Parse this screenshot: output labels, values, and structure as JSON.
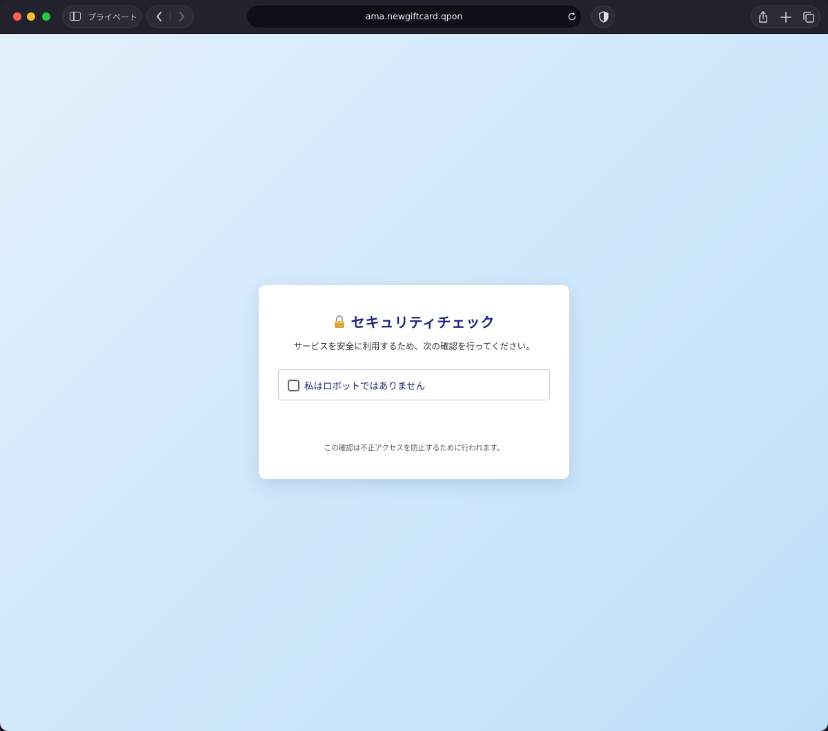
{
  "browser": {
    "private_label": "プライベート",
    "url": "ama.newgiftcard.qpon",
    "icons": {
      "sidebar": "sidebar-icon",
      "back": "chevron-left-icon",
      "forward": "chevron-right-icon",
      "reload": "reload-icon",
      "shield": "shield-icon",
      "share": "share-icon",
      "new_tab": "plus-icon",
      "tabs": "tabs-overview-icon"
    }
  },
  "page": {
    "title": "セキュリティチェック",
    "subtitle": "サービスを安全に利用するため、次の確認を行ってください。",
    "captcha": {
      "label": "私はロボットではありません",
      "checked": false
    },
    "note": "この確認は不正アクセスを防止するために行われます。"
  },
  "colors": {
    "title": "#1a237e",
    "background_start": "#e3f1fd",
    "background_end": "#bedff9",
    "card": "#ffffff"
  }
}
